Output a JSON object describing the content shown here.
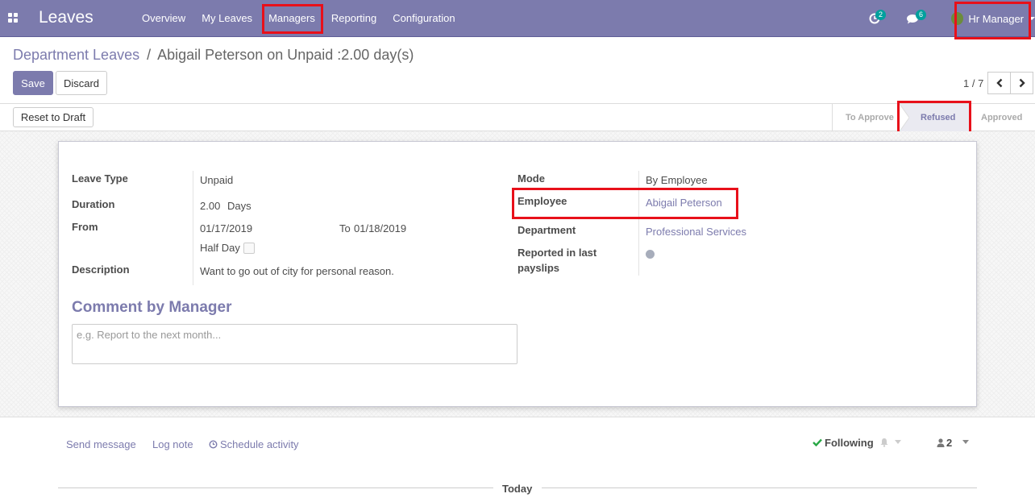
{
  "app": {
    "brand": "Leaves"
  },
  "menu": [
    {
      "label": "Overview"
    },
    {
      "label": "My Leaves"
    },
    {
      "label": "Managers"
    },
    {
      "label": "Reporting"
    },
    {
      "label": "Configuration"
    }
  ],
  "systray": {
    "activity_count": "2",
    "message_count": "6",
    "user_name": "Hr Manager"
  },
  "breadcrumb": {
    "parent": "Department Leaves",
    "separator": "/",
    "current": "Abigail Peterson on Unpaid :2.00 day(s)"
  },
  "buttons": {
    "save": "Save",
    "discard": "Discard",
    "reset": "Reset to Draft"
  },
  "pager": {
    "value": "1 / 7"
  },
  "status_stages": [
    {
      "label": "To Approve",
      "active": false
    },
    {
      "label": "Refused",
      "active": true
    },
    {
      "label": "Approved",
      "active": false
    }
  ],
  "form": {
    "leave_type": {
      "label": "Leave Type",
      "value": "Unpaid"
    },
    "duration": {
      "label": "Duration",
      "value": "2.00",
      "unit": "Days"
    },
    "from": {
      "label": "From",
      "value": "01/17/2019",
      "to_label": "To",
      "to_value": "01/18/2019"
    },
    "half_day": {
      "label": "Half Day"
    },
    "description": {
      "label": "Description",
      "value": "Want to go out of city for personal reason."
    },
    "mode": {
      "label": "Mode",
      "value": "By Employee"
    },
    "employee": {
      "label": "Employee",
      "value": "Abigail Peterson"
    },
    "department": {
      "label": "Department",
      "value": "Professional Services"
    },
    "reported": {
      "label_line1": "Reported in last",
      "label_line2": "payslips"
    },
    "comment": {
      "title": "Comment by Manager",
      "placeholder": "e.g. Report to the next month..."
    }
  },
  "chatter": {
    "send_message": "Send message",
    "log_note": "Log note",
    "schedule_activity": "Schedule activity",
    "following": "Following",
    "followers_count": "2",
    "today": "Today"
  },
  "colors": {
    "brand": "#7c7bad",
    "highlight": "#e8101a",
    "success": "#28a745"
  }
}
